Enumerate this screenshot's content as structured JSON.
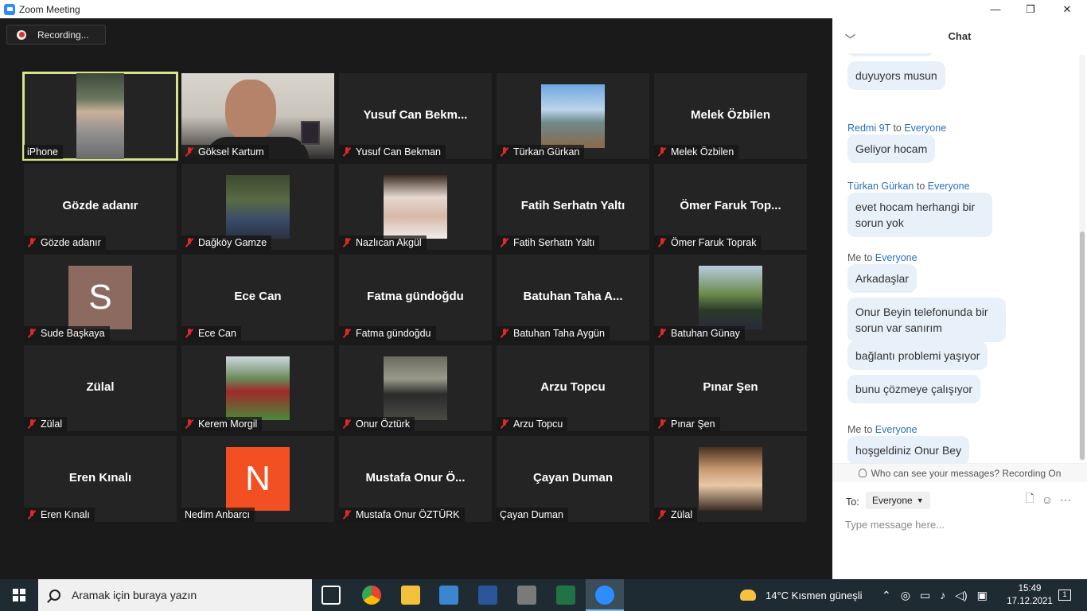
{
  "window": {
    "title": "Zoom Meeting",
    "minimize": "—",
    "maximize": "❐",
    "close": "✕"
  },
  "recording": {
    "label": "Recording..."
  },
  "tiles": [
    {
      "big": "",
      "name": "iPhone",
      "muted": false,
      "kind": "iphone"
    },
    {
      "big": "",
      "name": "Göksel Kartum",
      "muted": true,
      "kind": "goksel"
    },
    {
      "big": "Yusuf Can Bekm...",
      "name": "Yusuf Can Bekman",
      "muted": true,
      "kind": "text"
    },
    {
      "big": "",
      "name": "Türkan Gürkan",
      "muted": true,
      "kind": "photo",
      "color": "linear-gradient(180deg,#6fa6e0 0%,#bcd4ea 40%,#6f8a8a 60%,#8a6a4a 100%)"
    },
    {
      "big": "Melek Özbilen",
      "name": "Melek Özbilen",
      "muted": true,
      "kind": "text"
    },
    {
      "big": "Gözde adanır",
      "name": "Gözde adanır",
      "muted": true,
      "kind": "text"
    },
    {
      "big": "",
      "name": "Dağköy Gamze",
      "muted": true,
      "kind": "photo",
      "color": "linear-gradient(180deg,#3c4a30 0%,#5a6a44 40%,#3a4c6a 70%,#2a3040 100%)"
    },
    {
      "big": "",
      "name": "Nazlıcan Akgül",
      "muted": true,
      "kind": "photo",
      "color": "linear-gradient(180deg,#3a2a22 0%,#e6d8d0 35%,#d8b8a8 65%,#f0ece8 100%)"
    },
    {
      "big": "Fatih Serhatn Yaltı",
      "name": "Fatih Serhatn Yaltı",
      "muted": true,
      "kind": "text"
    },
    {
      "big": "Ömer Faruk Top...",
      "name": "Ömer Faruk Toprak",
      "muted": true,
      "kind": "text"
    },
    {
      "big": "",
      "name": "Sude Başkaya",
      "muted": true,
      "kind": "letter",
      "letter": "S",
      "color": "#8c6a60"
    },
    {
      "big": "Ece Can",
      "name": "Ece Can",
      "muted": true,
      "kind": "text"
    },
    {
      "big": "Fatma gündoğdu",
      "name": "Fatma gündoğdu",
      "muted": true,
      "kind": "text"
    },
    {
      "big": "Batuhan Taha A...",
      "name": "Batuhan Taha Aygün",
      "muted": true,
      "kind": "text"
    },
    {
      "big": "",
      "name": "Batuhan Günay",
      "muted": true,
      "kind": "photo",
      "color": "linear-gradient(180deg,#b8cce0 0%,#6a8a4a 45%,#2a3a2a 70%,#2a2a3a 100%)"
    },
    {
      "big": "Zülal",
      "name": "Zülal",
      "muted": true,
      "kind": "text"
    },
    {
      "big": "",
      "name": "Kerem Morgil",
      "muted": true,
      "kind": "photo",
      "color": "linear-gradient(180deg,#cfd8e0 0%,#6a8a5a 35%,#a02a2a 55%,#4a8a3a 100%)"
    },
    {
      "big": "",
      "name": "Onur Öztürk",
      "muted": true,
      "kind": "photo",
      "color": "linear-gradient(180deg,#6a6a60 0%,#9a9a8a 35%,#2a2a2a 60%,#4a4a44 100%)"
    },
    {
      "big": "Arzu Topcu",
      "name": "Arzu Topcu",
      "muted": true,
      "kind": "text"
    },
    {
      "big": "Pınar Şen",
      "name": "Pınar Şen",
      "muted": true,
      "kind": "text"
    },
    {
      "big": "Eren Kınalı",
      "name": "Eren Kınalı",
      "muted": true,
      "kind": "text"
    },
    {
      "big": "",
      "name": "Nedim Anbarcı",
      "muted": false,
      "kind": "letter",
      "letter": "N",
      "color": "#f25022"
    },
    {
      "big": "Mustafa Onur Ö...",
      "name": "Mustafa Onur ÖZTÜRK",
      "muted": true,
      "kind": "text"
    },
    {
      "big": "Çayan Duman",
      "name": "Çayan Duman",
      "muted": false,
      "kind": "text"
    },
    {
      "big": "",
      "name": "Zülal",
      "muted": true,
      "kind": "photo",
      "color": "linear-gradient(180deg,#4a3020 0%,#c89a70 35%,#e8c8a8 60%,#3a2a22 100%)"
    }
  ],
  "chat": {
    "title": "Chat",
    "messages": [
      {
        "type": "bubble",
        "text": "duyuyors musun"
      },
      {
        "type": "sender",
        "from": "Redmi 9T",
        "sep": " to ",
        "to": "Everyone"
      },
      {
        "type": "bubble",
        "text": "Geliyor hocam"
      },
      {
        "type": "sender",
        "from": "Türkan Gürkan",
        "sep": " to ",
        "to": "Everyone"
      },
      {
        "type": "bubble",
        "text": "evet hocam herhangi bir sorun yok"
      },
      {
        "type": "sender",
        "from": "Me",
        "sep": " to ",
        "to": "Everyone"
      },
      {
        "type": "bubble",
        "text": "Arkadaşlar"
      },
      {
        "type": "bubble",
        "text": "Onur Beyin telefonunda bir sorun var sanırım"
      },
      {
        "type": "bubble",
        "text": "bağlantı problemi yaşıyor"
      },
      {
        "type": "bubble",
        "text": "bunu çözmeye çalışıyor"
      },
      {
        "type": "sender",
        "from": "Me",
        "sep": " to ",
        "to": "Everyone"
      },
      {
        "type": "bubble",
        "text": "hoşgeldiniz Onur Bey"
      }
    ],
    "privacy": "Who can see your messages? Recording On",
    "to_label": "To:",
    "to_value": "Everyone",
    "placeholder": "Type message here..."
  },
  "taskbar": {
    "search": "Aramak için buraya yazın",
    "weather": "14°C  Kısmen güneşli",
    "time": "15:49",
    "date": "17.12.2021",
    "notifications": "1"
  }
}
